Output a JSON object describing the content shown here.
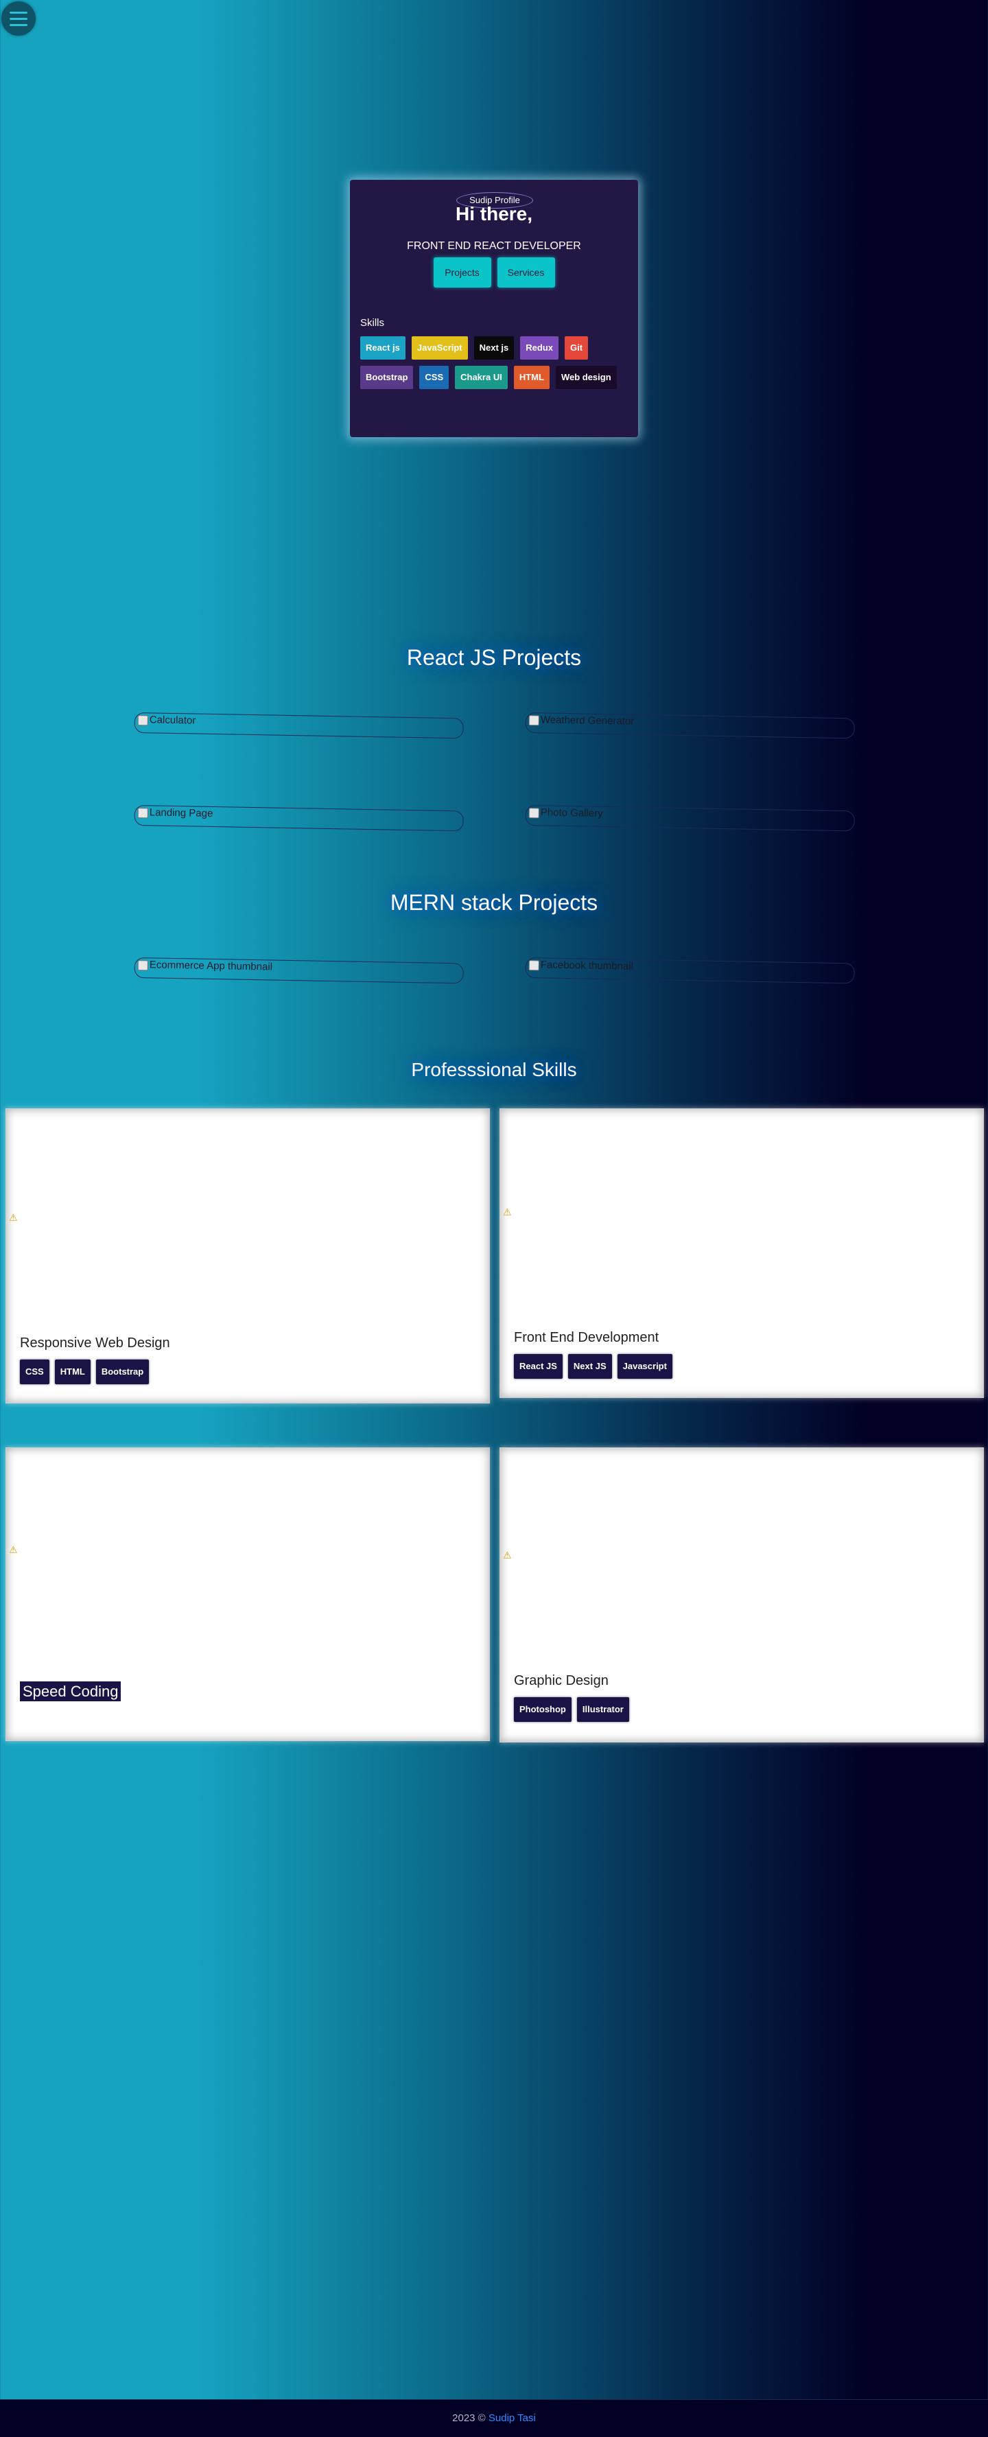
{
  "nav": {
    "menu_icon": "hamburger-icon"
  },
  "profile": {
    "image_alt": "Sudip Profile",
    "heading": "Hi there,",
    "role": "FRONT END REACT DEVELOPER",
    "buttons": [
      "Projects",
      "Services"
    ],
    "skills_label": "Skills",
    "skills": [
      {
        "label": "React js",
        "color": "#1aa3c4"
      },
      {
        "label": "JavaScript",
        "color": "#e2c019"
      },
      {
        "label": "Next js",
        "color": "#0a0a0a"
      },
      {
        "label": "Redux",
        "color": "#7a4bb8"
      },
      {
        "label": "Git",
        "color": "#e5483a"
      },
      {
        "label": "Bootstrap",
        "color": "#5a3a8a"
      },
      {
        "label": "CSS",
        "color": "#1b6bb3"
      },
      {
        "label": "Chakra UI",
        "color": "#1a9a8a"
      },
      {
        "label": "HTML",
        "color": "#e05a2a"
      },
      {
        "label": "Web design",
        "color": "#1a0a2a"
      }
    ]
  },
  "react_projects": {
    "title": "React JS Projects",
    "items": [
      "Calculator",
      "Weatherd Generator",
      "Landing Page",
      "Photo Gallery"
    ]
  },
  "mern_projects": {
    "title": "MERN stack Projects",
    "items": [
      "Ecommerce App thumbnail",
      "Facebook thumbnail"
    ]
  },
  "professional_skills": {
    "title": "Professsional Skills",
    "cards": [
      {
        "title": "Responsive Web Design",
        "tags": [
          "CSS",
          "HTML",
          "Bootstrap"
        ]
      },
      {
        "title": "Front End Development",
        "tags": [
          "React JS",
          "Next JS",
          "Javascript"
        ]
      },
      {
        "title": "Speed Coding",
        "tags": []
      },
      {
        "title": "Graphic Design",
        "tags": [
          "Photoshop",
          "Illustrator"
        ]
      }
    ]
  },
  "footer": {
    "text": "2023 ©",
    "name": "Sudip Tasi"
  }
}
